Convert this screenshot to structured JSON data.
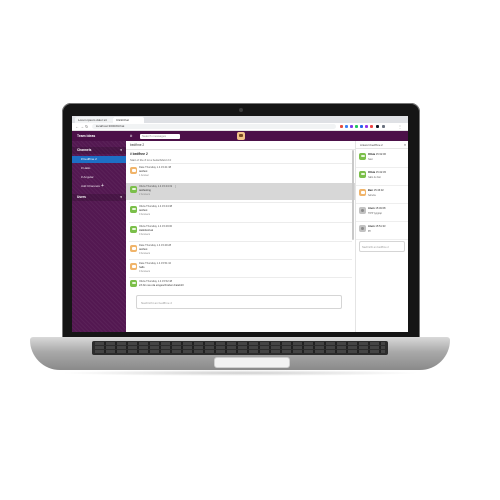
{
  "browser": {
    "tabs": [
      {
        "label": "Lorem ipsum dolor sit"
      },
      {
        "label": "ClickChat"
      }
    ],
    "url": "localhost:3000/#/chat"
  },
  "header": {
    "team_name": "Team ideas",
    "hash": "#",
    "search_placeholder": "Search messages"
  },
  "sidebar": {
    "channels_label": "Channels",
    "items": [
      {
        "label": "# bedfhne 2",
        "active": true
      },
      {
        "label": "# Hallo",
        "active": false
      },
      {
        "label": "# Angular",
        "active": false
      }
    ],
    "add_channel_label": "Add Channels",
    "users_label": "Users",
    "chevron": "▾",
    "plus": "+"
  },
  "main": {
    "channel_header": "bedfhne 2",
    "channel_title": "# bedfhne 2",
    "channel_intro": "Start of the # ist a bedarfsfeld 2.0",
    "messages": [
      {
        "avatar": "fox",
        "meta": "Date Thursday 1.4 15:41:38",
        "text": "testfest",
        "sub": "1 Answer",
        "highlight": false
      },
      {
        "avatar": "frog",
        "meta": "Olivia Thursday 1.4 15:44:19",
        "text": "testfesting",
        "sub": "2 Answers",
        "highlight": true
      },
      {
        "avatar": "frog",
        "meta": "Olivia Thursday 1.4 15:44:38",
        "text": "testfest",
        "sub": "0 Answers",
        "highlight": false
      },
      {
        "avatar": "frog",
        "meta": "Olivia Thursday 1.4 15:49:00",
        "text": "Hallofestival",
        "sub": "0 Answers",
        "highlight": false
      },
      {
        "avatar": "fox",
        "meta": "Date Thursday 1.4 15:49:28",
        "text": "testfest",
        "sub": "0 Answers",
        "highlight": false
      },
      {
        "avatar": "fox",
        "meta": "Date Thursday 1.4 15:51:10",
        "text": "hallo",
        "sub": "0 Answers",
        "highlight": false
      },
      {
        "avatar": "frog",
        "meta": "Olivia Thursday 1.4 15:52:48",
        "text": "ich bin neu da eingeschrieben Fatebrill",
        "sub": "",
        "highlight": false
      }
    ],
    "composer_placeholder": "Nachricht an bedfhne 2",
    "message_icon": "⋮"
  },
  "thread": {
    "title": "Antwort bedfhne 2",
    "close": "×",
    "replies": [
      {
        "avatar": "frog",
        "name": "Olivia",
        "time": "15:32:06",
        "text": "hast"
      },
      {
        "avatar": "frog",
        "name": "Olivia",
        "time": "15:42:45",
        "text": "hallo du bist"
      },
      {
        "avatar": "fox",
        "name": "Ben",
        "time": "15:46:32",
        "text": "hehehe"
      },
      {
        "avatar": "gray",
        "name": "Anon",
        "time": "15:49:08",
        "text": "TIPP typgrap"
      },
      {
        "avatar": "gray",
        "name": "Anon",
        "time": "15:51:33",
        "text": "ffff"
      }
    ],
    "composer_placeholder": "Nachricht an bedfhne 2"
  },
  "colors": {
    "sidebar": "#531851",
    "header": "#4b1048",
    "active_item": "#1d6fc5",
    "highlight_row": "#d7d7d7"
  }
}
